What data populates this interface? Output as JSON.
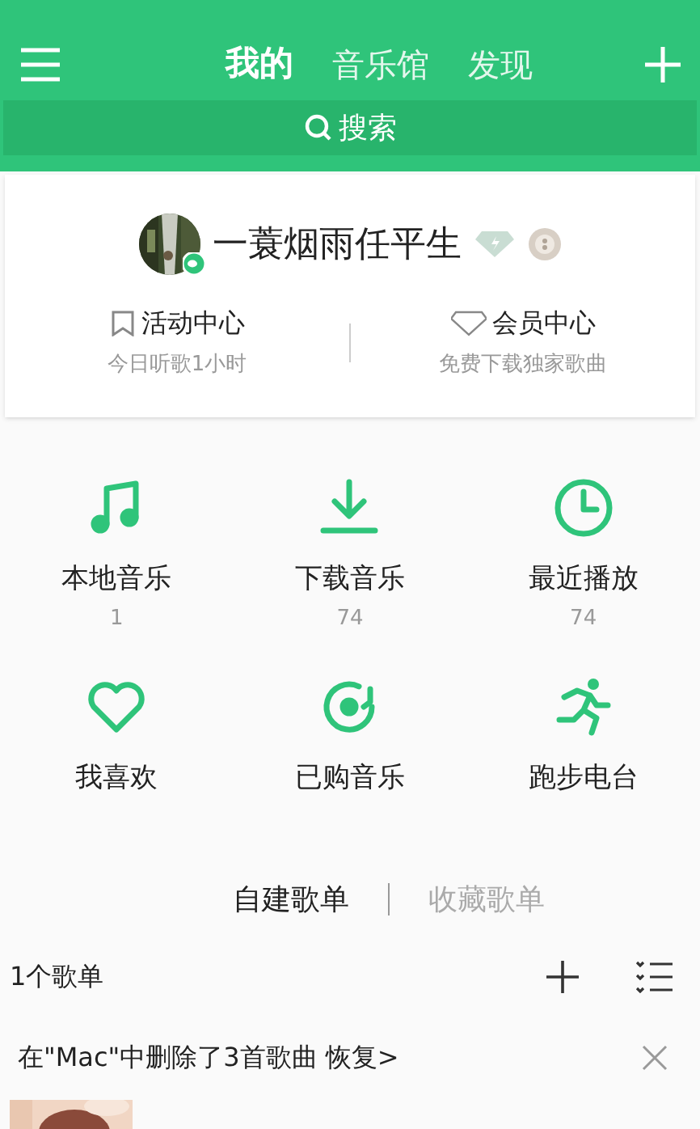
{
  "nav": {
    "tabs": [
      {
        "label": "我的",
        "selected": true
      },
      {
        "label": "音乐馆",
        "selected": false
      },
      {
        "label": "发现",
        "selected": false
      }
    ]
  },
  "search": {
    "placeholder": "搜索"
  },
  "profile": {
    "name": "一蓑烟雨任平生",
    "links": [
      {
        "kind": "activity",
        "title": "活动中心",
        "subtitle": "今日听歌1小时"
      },
      {
        "kind": "vip",
        "title": "会员中心",
        "subtitle": "免费下载独家歌曲"
      }
    ]
  },
  "shortcuts": [
    {
      "kind": "note",
      "label": "本地音乐",
      "count": "1"
    },
    {
      "kind": "download",
      "label": "下载音乐",
      "count": "74"
    },
    {
      "kind": "clock",
      "label": "最近播放",
      "count": "74"
    },
    {
      "kind": "heart",
      "label": "我喜欢"
    },
    {
      "kind": "disc",
      "label": "已购音乐"
    },
    {
      "kind": "run",
      "label": "跑步电台"
    }
  ],
  "playlist_tabs": [
    {
      "label": "自建歌单",
      "selected": true
    },
    {
      "label": "收藏歌单",
      "selected": false
    }
  ],
  "playlist_count": "1个歌单",
  "notice": {
    "text": "在\"Mac\"中删除了3首歌曲 恢复>"
  }
}
